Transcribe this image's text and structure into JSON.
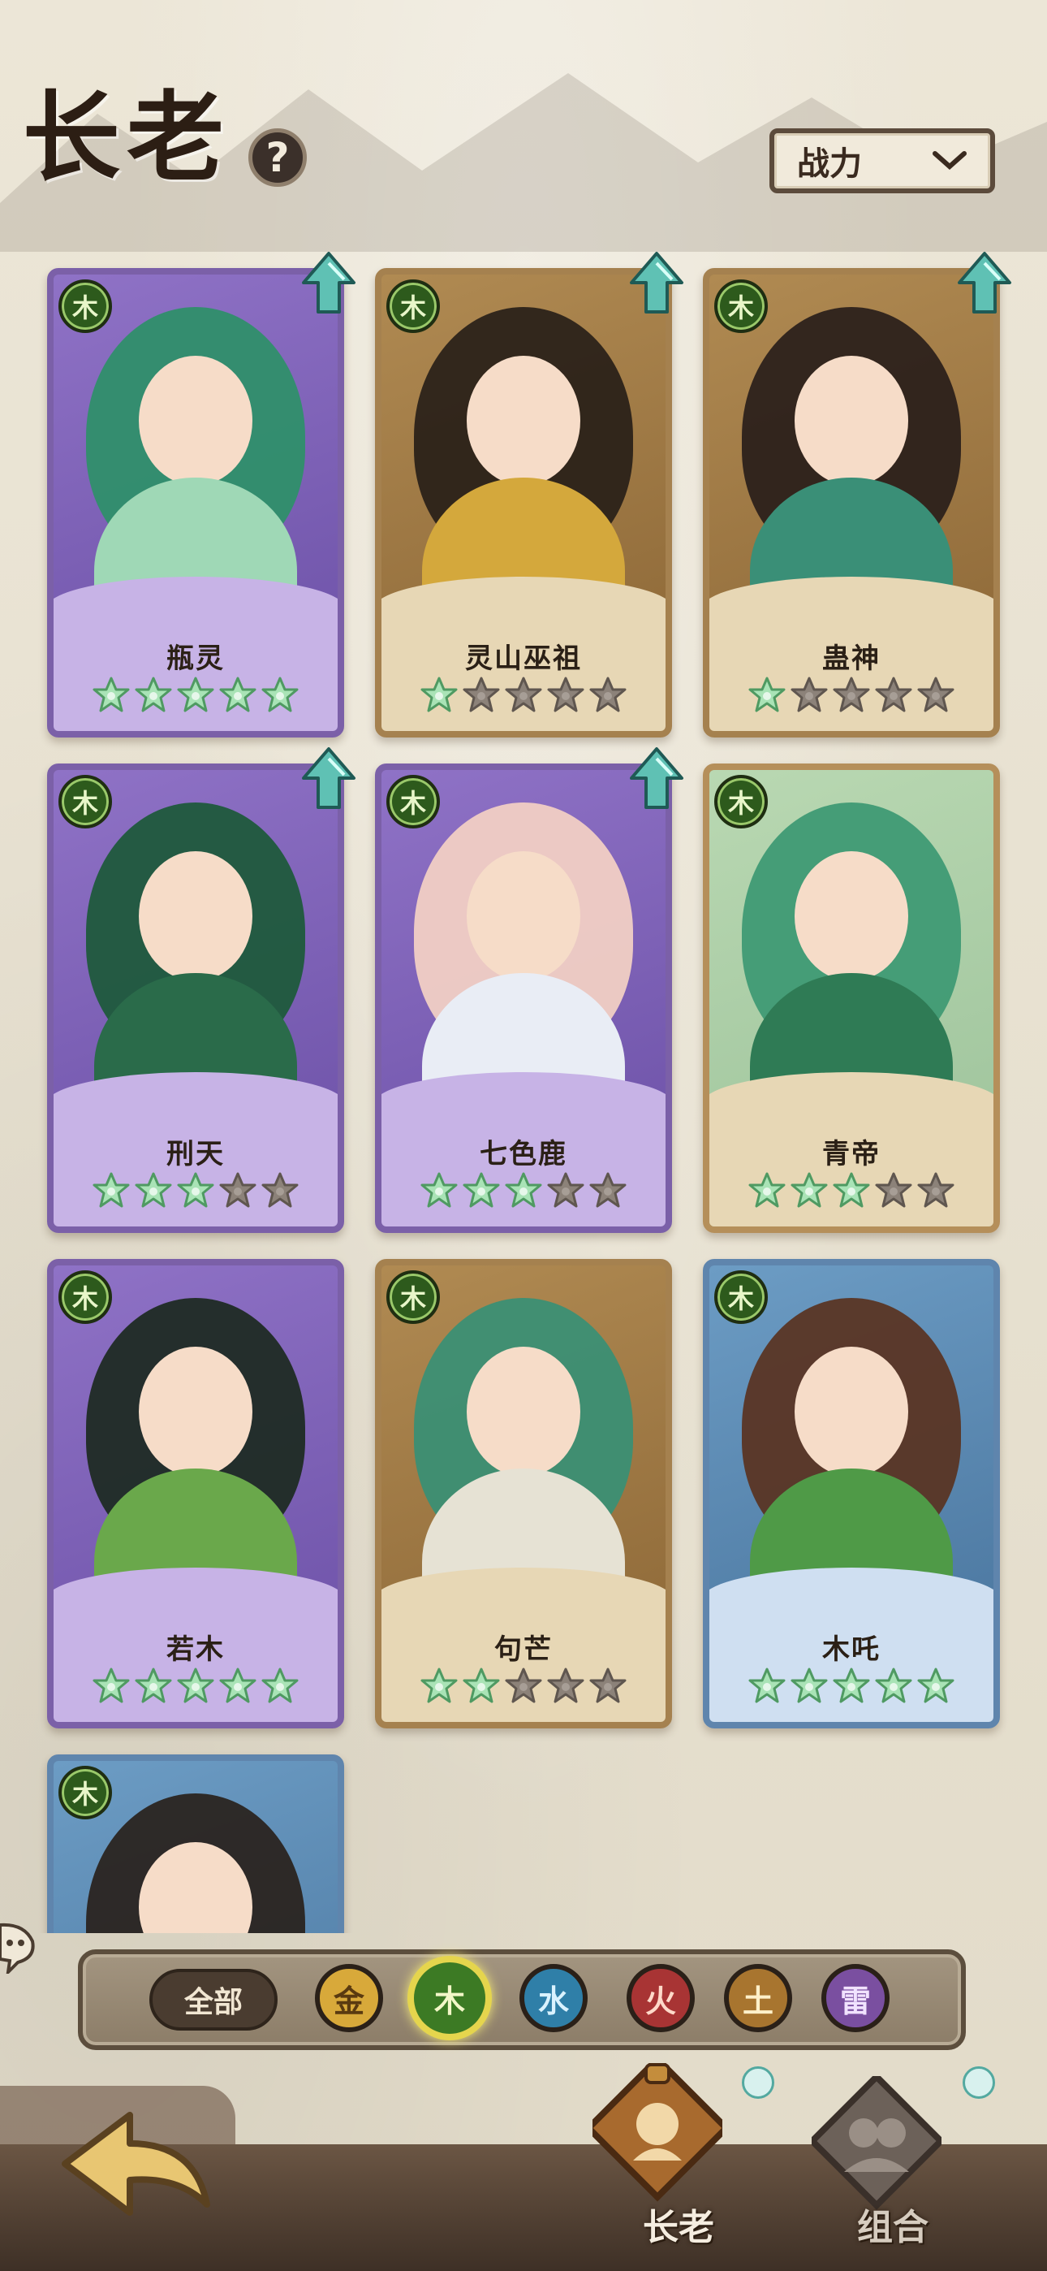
{
  "header": {
    "title": "长老",
    "help_icon": "question-mark-icon",
    "sort_label": "战力"
  },
  "cards": [
    {
      "name": "瓶灵",
      "element": "木",
      "frame": "purple",
      "stars": 5,
      "upgrade": true,
      "hair": "#2f8f6a",
      "robe": "#9fd8b6"
    },
    {
      "name": "灵山巫祖",
      "element": "木",
      "frame": "brown",
      "stars": 1,
      "upgrade": true,
      "hair": "#2b2219",
      "robe": "#d4a83c"
    },
    {
      "name": "蛊神",
      "element": "木",
      "frame": "brown",
      "stars": 1,
      "upgrade": true,
      "hair": "#2c211b",
      "robe": "#3a8f77"
    },
    {
      "name": "刑天",
      "element": "木",
      "frame": "purple",
      "stars": 3,
      "upgrade": true,
      "hair": "#1f5a3c",
      "robe": "#2a6b4a"
    },
    {
      "name": "七色鹿",
      "element": "木",
      "frame": "purple",
      "stars": 3,
      "upgrade": true,
      "hair": "#f1cfc4",
      "robe": "#e9edf5"
    },
    {
      "name": "青帝",
      "element": "木",
      "frame": "teal",
      "stars": 3,
      "upgrade": false,
      "hair": "#3f9a74",
      "robe": "#2f7b55"
    },
    {
      "name": "若木",
      "element": "木",
      "frame": "purple",
      "stars": 5,
      "upgrade": false,
      "hair": "#1f2b24",
      "robe": "#6aa84b"
    },
    {
      "name": "句芒",
      "element": "木",
      "frame": "brown",
      "stars": 2,
      "upgrade": false,
      "hair": "#3b8f74",
      "robe": "#e6e2d4"
    },
    {
      "name": "木吒",
      "element": "木",
      "frame": "blue",
      "stars": 5,
      "upgrade": false,
      "hair": "#5a3524",
      "robe": "#4f9a47"
    },
    {
      "name": "",
      "element": "木",
      "frame": "blue",
      "stars": 0,
      "upgrade": false,
      "hair": "#2a2420",
      "robe": "#3f8a5a"
    }
  ],
  "filters": {
    "all_label": "全部",
    "elements": [
      {
        "label": "金",
        "color": "#d8a93a",
        "text": "#5a3a10",
        "selected": false
      },
      {
        "label": "木",
        "color": "#3c7a24",
        "text": "#f3f7c8",
        "selected": true
      },
      {
        "label": "水",
        "color": "#2f7fa8",
        "text": "#d9f2ff",
        "selected": false
      },
      {
        "label": "火",
        "color": "#a83434",
        "text": "#ffd9c9",
        "selected": false
      },
      {
        "label": "土",
        "color": "#a8752f",
        "text": "#fff0c9",
        "selected": false
      },
      {
        "label": "雷",
        "color": "#7a4fa0",
        "text": "#f1e2ff",
        "selected": false
      }
    ]
  },
  "nav": {
    "back_icon": "back-arrow-icon",
    "tabs": [
      {
        "label": "长老",
        "icon": "elder-portrait-icon",
        "active": true
      },
      {
        "label": "组合",
        "icon": "combination-icon",
        "active": false
      }
    ]
  },
  "colors": {
    "star_filled": "#a9e3b6",
    "star_empty": "#8c8279",
    "upgrade_arrow": "#5fc1b4"
  }
}
